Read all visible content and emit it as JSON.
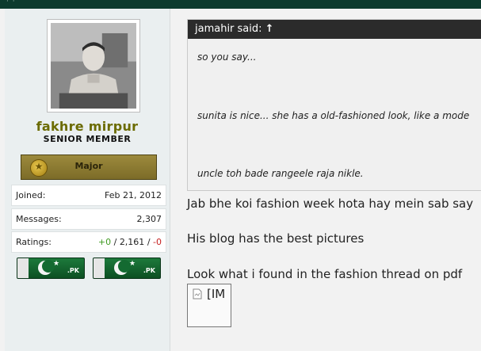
{
  "post": {
    "user": {
      "name": "fakhre mirpur",
      "title": "SENIOR MEMBER",
      "rank": "Major",
      "stats": {
        "joined_label": "Joined:",
        "joined_value": "Feb 21, 2012",
        "messages_label": "Messages:",
        "messages_value": "2,307",
        "ratings_label": "Ratings:",
        "ratings_positive": "+0",
        "ratings_sep1": "/",
        "ratings_neutral": "2,161",
        "ratings_sep2": "/",
        "ratings_negative": "-0"
      },
      "badges": [
        ".PK",
        ".PK"
      ]
    },
    "quote": {
      "author_said": "jamahir said:",
      "arrow": "↑",
      "lines": [
        "so you say...",
        "sunita is nice... she has a old-fashioned look, like a mode",
        "uncle toh bade rangeele raja nikle."
      ]
    },
    "body": [
      "Jab bhe koi fashion week hota hay mein sab say",
      "His blog has the best pictures",
      "Look what i found in the fashion thread on pdf"
    ],
    "broken_image_alt": "[IM"
  },
  "colors": {
    "topbar": "#0d3b2e",
    "username": "#6b6b00",
    "positive": "#3f9a21",
    "negative": "#c62020",
    "quote_header": "#2b2b2b"
  }
}
